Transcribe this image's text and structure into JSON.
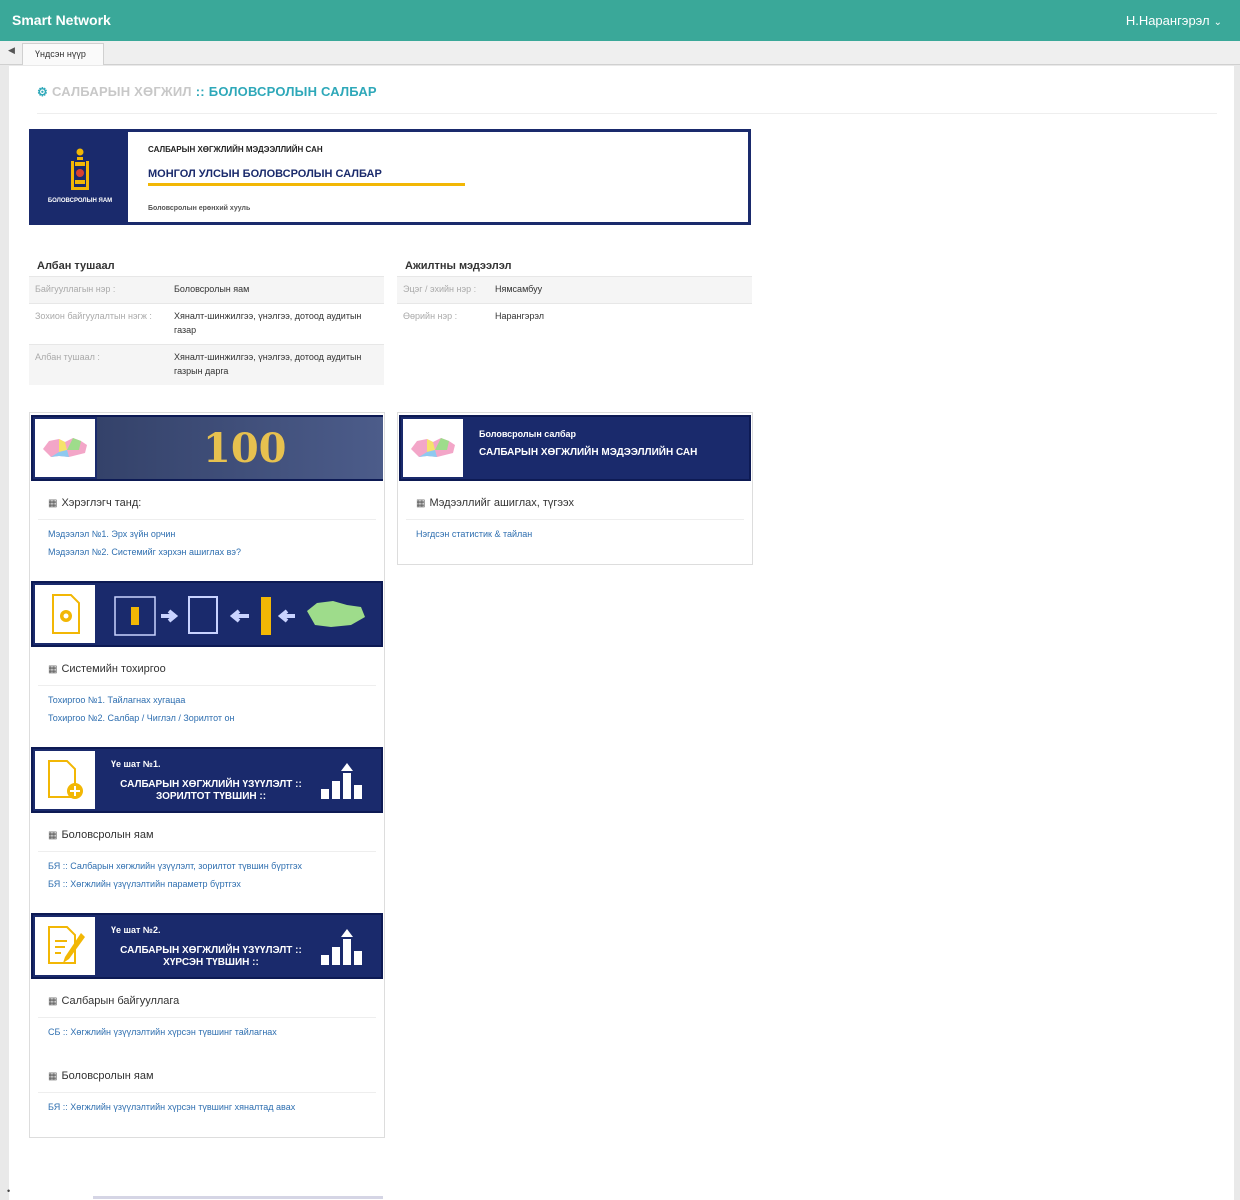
{
  "header": {
    "app_title": "Smart Network",
    "user_name": "Н.Нарангэрэл"
  },
  "tabs": [
    {
      "label": "Үндсэн нүүр"
    }
  ],
  "page": {
    "title_prefix": "САЛБАРЫН ХӨГЖИЛ",
    "title_sep": "::",
    "title_main": "БОЛОВСРОЛЫН САЛБАР"
  },
  "banner": {
    "ministry": "БОЛОВСРОЛЫН ЯАМ",
    "subtitle": "САЛБАРЫН ХӨГЖЛИЙН МЭДЭЭЛЛИЙН САН",
    "title": "МОНГОЛ УЛСЫН БОЛОВСРОЛЫН САЛБАР",
    "footer": "Боловсролын ерөнхий хууль"
  },
  "position": {
    "heading": "Албан тушаал",
    "rows": [
      {
        "key": "Байгууллагын нэр :",
        "value": "Боловсролын яам"
      },
      {
        "key": "Зохион байгуулалтын нэгж :",
        "value": "Хяналт-шинжилгээ, үнэлгээ, дотоод аудитын газар"
      },
      {
        "key": "Албан тушаал :",
        "value": "Хяналт-шинжилгээ, үнэлгээ, дотоод аудитын газрын дарга"
      }
    ]
  },
  "employee": {
    "heading": "Ажилтны мэдээлэл",
    "rows": [
      {
        "key": "Эцэг / эхийн нэр :",
        "value": "Нямсамбуу"
      },
      {
        "key": "Өөрийн нэр :",
        "value": "Нарангэрэл"
      }
    ]
  },
  "left_panel": {
    "user_heading": "Хэрэглэгч танд:",
    "user_links": [
      "Мэдээлэл №1. Эрх зүйн орчин",
      "Мэдээлэл №2. Системийг хэрхэн ашиглах вэ?"
    ],
    "settings_heading": "Системийн тохиргоо",
    "settings_links": [
      "Тохиргоо №1. Тайлагнах хугацаа",
      "Тохиргоо №2. Салбар / Чиглэл / Зорилтот он"
    ],
    "stage1_label": "Үе шат №1.",
    "stage1_title": "САЛБАРЫН ХӨГЖЛИЙН ҮЗҮҮЛЭЛТ :: ЗОРИЛТОТ ТҮВШИН ::",
    "ministry_heading": "Боловсролын яам",
    "ministry_links": [
      "БЯ :: Салбарын хөгжлийн үзүүлэлт, зорилтот түвшин бүртгэх",
      "БЯ :: Хөгжлийн үзүүлэлтийн параметр бүртгэх"
    ],
    "stage2_label": "Үе шат №2.",
    "stage2_title": "САЛБАРЫН ХӨГЖЛИЙН ҮЗҮҮЛЭЛТ :: ХҮРСЭН ТҮВШИН ::",
    "org_heading": "Салбарын байгууллага",
    "org_links": [
      "СБ :: Хөгжлийн үзүүлэлтийн хүрсэн түвшинг тайлагнах"
    ],
    "ministry2_heading": "Боловсролын яам",
    "ministry2_links": [
      "БЯ :: Хөгжлийн үзүүлэлтийн хүрсэн түвшинг хяналтад авах"
    ]
  },
  "right_panel": {
    "banner_sub": "Боловсролын салбар",
    "banner_title": "САЛБАРЫН ХӨГЖЛИЙН МЭДЭЭЛЛИЙН САН",
    "heading": "Мэдээллийг ашиглах, түгээх",
    "links": [
      "Нэгдсэн статистик & тайлан"
    ]
  },
  "banner_badge": "100",
  "colors": {
    "topbar": "#3aa899",
    "navy": "#1a2a6c",
    "accent": "#2ea8b9",
    "gold": "#f2b705",
    "link": "#2f6fb0"
  }
}
